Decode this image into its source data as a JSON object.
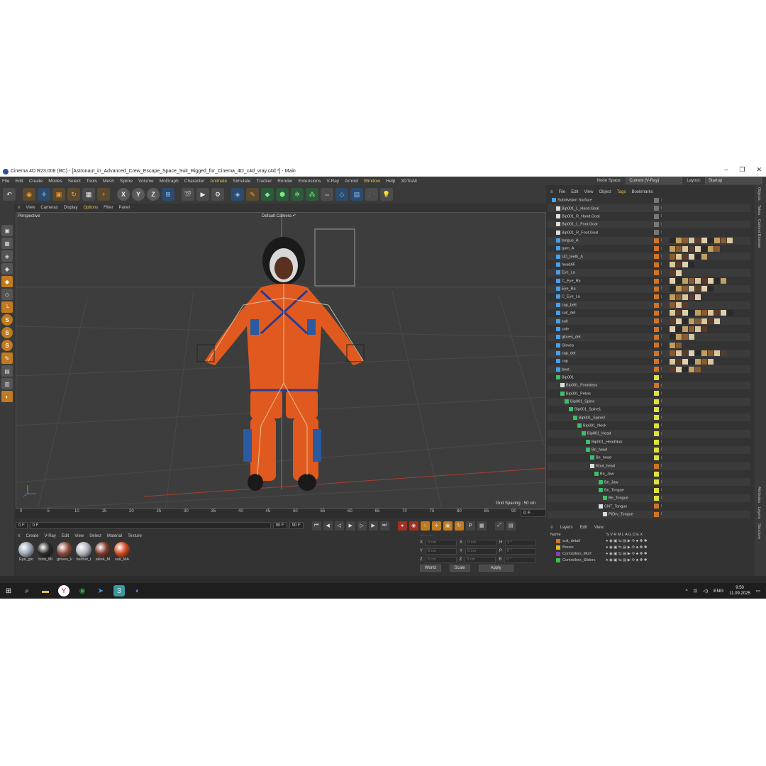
{
  "window": {
    "title": "Cinema 4D R23.008 (RC) - [Astronaut_in_Advanced_Crew_Escape_Space_Suit_Rigged_for_Cinema_4D_c4d_vray.c4d *] - Main",
    "minimize": "–",
    "maximize": "❐",
    "close": "✕"
  },
  "menu": [
    "File",
    "Edit",
    "Create",
    "Modes",
    "Select",
    "Tools",
    "Mesh",
    "Spline",
    "Volume",
    "MoGraph",
    "Character",
    "Animate",
    "Simulate",
    "Tracker",
    "Render",
    "Extensions",
    "V-Ray",
    "Arnold",
    "Window",
    "Help",
    "3DToAll"
  ],
  "node_space": {
    "label": "Node Space:",
    "value": "Current (V-Ray)"
  },
  "layout": {
    "label": "Layout:",
    "value": "Startup"
  },
  "viewport": {
    "menu": [
      "View",
      "Cameras",
      "Display",
      "Options",
      "Filter",
      "Panel"
    ],
    "label": "Perspective",
    "camera": "Default Camera •°",
    "grid_spacing": "Grid Spacing : 50 cm"
  },
  "timeline": {
    "ticks": [
      "0",
      "5",
      "10",
      "15",
      "20",
      "25",
      "30",
      "35",
      "40",
      "45",
      "50",
      "55",
      "60",
      "65",
      "70",
      "75",
      "80",
      "85",
      "90"
    ],
    "current": "0 F",
    "start": "0 F",
    "range_start": "0 F",
    "range_end": "90 F",
    "end": "90 F",
    "right_field": "0 F"
  },
  "materials": {
    "menu": [
      "Create",
      "V-Ray",
      "Edit",
      "View",
      "Select",
      "Material",
      "Texture"
    ],
    "items": [
      {
        "name": "Eye_glo",
        "color": "#9aa7b5"
      },
      {
        "name": "boot_Mi",
        "color": "#2a2a2a"
      },
      {
        "name": "gloves_k",
        "color": "#8a4a3a"
      },
      {
        "name": "helmet_t",
        "color": "#aeb4bc"
      },
      {
        "name": "skin4_M",
        "color": "#7a3a2a"
      },
      {
        "name": "suit_MA",
        "color": "#d04a20"
      }
    ]
  },
  "coords": {
    "rows": [
      {
        "a": "X",
        "av": "0 cm",
        "b": "X",
        "bv": "0 cm",
        "c": "H",
        "cv": "0 °"
      },
      {
        "a": "Y",
        "av": "0 cm",
        "b": "Y",
        "bv": "0 cm",
        "c": "P",
        "cv": "0 °"
      },
      {
        "a": "Z",
        "av": "0 cm",
        "b": "Z",
        "bv": "0 cm",
        "c": "B",
        "cv": "0 °"
      }
    ],
    "world": "World",
    "scale": "Scale",
    "apply": "Apply"
  },
  "objects": {
    "menu": [
      "File",
      "Edit",
      "View",
      "Object",
      "Tags",
      "Bookmarks"
    ],
    "rows": [
      {
        "name": "Subdivision Surface",
        "indent": 0,
        "icon": "#4aa0e8",
        "sw": "#777"
      },
      {
        "name": "Bip001_L_Hand.Goal",
        "indent": 1,
        "icon": "#ddd",
        "sw": "#777"
      },
      {
        "name": "Bip001_R_Hand.Goal",
        "indent": 1,
        "icon": "#ddd",
        "sw": "#777"
      },
      {
        "name": "Bip001_L_Foot.Goal",
        "indent": 1,
        "icon": "#ddd",
        "sw": "#777"
      },
      {
        "name": "Bip001_R_Foot.Goal",
        "indent": 1,
        "icon": "#ddd",
        "sw": "#777"
      },
      {
        "name": "tongue_A",
        "indent": 1,
        "icon": "#4aa0e8",
        "sw": "#d0742a"
      },
      {
        "name": "gum_A",
        "indent": 1,
        "icon": "#4aa0e8",
        "sw": "#d0742a"
      },
      {
        "name": "UD_teeth_A",
        "indent": 1,
        "icon": "#4aa0e8",
        "sw": "#d0742a"
      },
      {
        "name": "headAF",
        "indent": 1,
        "icon": "#4aa0e8",
        "sw": "#d0742a"
      },
      {
        "name": "Eye_La",
        "indent": 1,
        "icon": "#4aa0e8",
        "sw": "#d0742a"
      },
      {
        "name": "C_Eye_Ra",
        "indent": 1,
        "icon": "#4aa0e8",
        "sw": "#d0742a"
      },
      {
        "name": "Eye_Ra",
        "indent": 1,
        "icon": "#4aa0e8",
        "sw": "#d0742a"
      },
      {
        "name": "C_Eye_La",
        "indent": 1,
        "icon": "#4aa0e8",
        "sw": "#d0742a"
      },
      {
        "name": "cap_belt",
        "indent": 1,
        "icon": "#4aa0e8",
        "sw": "#d0742a"
      },
      {
        "name": "suit_det",
        "indent": 1,
        "icon": "#4aa0e8",
        "sw": "#d0742a"
      },
      {
        "name": "suit",
        "indent": 1,
        "icon": "#4aa0e8",
        "sw": "#d0742a"
      },
      {
        "name": "sole",
        "indent": 1,
        "icon": "#4aa0e8",
        "sw": "#d0742a"
      },
      {
        "name": "gloves_det",
        "indent": 1,
        "icon": "#4aa0e8",
        "sw": "#d0742a"
      },
      {
        "name": "Gloves",
        "indent": 1,
        "icon": "#4aa0e8",
        "sw": "#d0742a"
      },
      {
        "name": "cap_det",
        "indent": 1,
        "icon": "#4aa0e8",
        "sw": "#d0742a"
      },
      {
        "name": "cap",
        "indent": 1,
        "icon": "#4aa0e8",
        "sw": "#d0742a"
      },
      {
        "name": "boot",
        "indent": 1,
        "icon": "#4aa0e8",
        "sw": "#d0742a"
      },
      {
        "name": "Bip001",
        "indent": 1,
        "icon": "#3ac06a",
        "sw": "#e0e040"
      },
      {
        "name": "Bip001_Footsteps",
        "indent": 2,
        "icon": "#ddd",
        "sw": "#d0742a"
      },
      {
        "name": "Bip001_Pelvis",
        "indent": 2,
        "icon": "#3ac06a",
        "sw": "#e0e040"
      },
      {
        "name": "Bip001_Spine",
        "indent": 3,
        "icon": "#3ac06a",
        "sw": "#e0e040"
      },
      {
        "name": "Bip001_Spine1",
        "indent": 4,
        "icon": "#3ac06a",
        "sw": "#e0e040"
      },
      {
        "name": "Bip001_Spine2",
        "indent": 5,
        "icon": "#3ac06a",
        "sw": "#e0e040"
      },
      {
        "name": "Bip001_Neck",
        "indent": 6,
        "icon": "#3ac06a",
        "sw": "#e0e040"
      },
      {
        "name": "Bip001_Head",
        "indent": 7,
        "icon": "#3ac06a",
        "sw": "#e0e040"
      },
      {
        "name": "Bip001_HeadNub",
        "indent": 8,
        "icon": "#3ac06a",
        "sw": "#e0e040"
      },
      {
        "name": "Bn_head",
        "indent": 8,
        "icon": "#3ac06a",
        "sw": "#e0e040"
      },
      {
        "name": "Be_head",
        "indent": 9,
        "icon": "#3ac06a",
        "sw": "#e0e040"
      },
      {
        "name": "Root_head",
        "indent": 9,
        "icon": "#ddd",
        "sw": "#d0742a"
      },
      {
        "name": "Bn_Jaw",
        "indent": 10,
        "icon": "#3ac06a",
        "sw": "#e0e040"
      },
      {
        "name": "Be_Jaw",
        "indent": 11,
        "icon": "#3ac06a",
        "sw": "#e0e040"
      },
      {
        "name": "Bn_Tongue",
        "indent": 11,
        "icon": "#3ac06a",
        "sw": "#e0e040"
      },
      {
        "name": "Be_Tongue",
        "indent": 12,
        "icon": "#3ac06a",
        "sw": "#e0e040"
      },
      {
        "name": "CNT_Tongue",
        "indent": 11,
        "icon": "#ddd",
        "sw": "#d0742a"
      },
      {
        "name": "PtDrv_Tongue",
        "indent": 12,
        "icon": "#ddd",
        "sw": "#d0742a"
      }
    ]
  },
  "side_tabs": [
    "Objects",
    "Takes",
    "Content Browser"
  ],
  "side_tabs_lower": [
    "Attributes",
    "Layers",
    "Structure"
  ],
  "layers": {
    "menu": [
      "Layers",
      "Edit",
      "View"
    ],
    "header_name": "Name",
    "header_cols": "S V R M L A G D E X",
    "rows": [
      {
        "name": "suit_detail",
        "color": "#d0742a"
      },
      {
        "name": "Bones",
        "color": "#e0c020"
      },
      {
        "name": "Controllers_Morf",
        "color": "#8a3ac0"
      },
      {
        "name": "Controllers_Sliders",
        "color": "#40c040"
      }
    ]
  },
  "taskbar": {
    "lang": "ENG",
    "time": "9:50",
    "date": "11.09.2025"
  }
}
